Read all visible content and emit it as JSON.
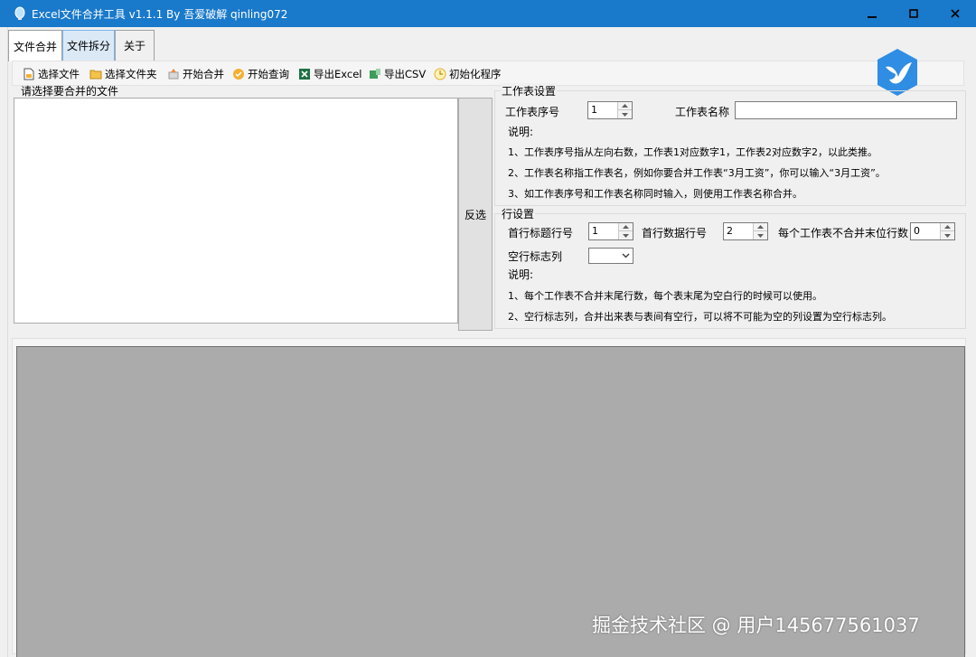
{
  "window": {
    "title": "Excel文件合并工具 v1.1.1 By 吾爱破解 qinling072",
    "colors": {
      "titlebar": "#1979ca",
      "grid_bg": "#ababab"
    }
  },
  "tabs": [
    {
      "label": "文件合并",
      "selected": true
    },
    {
      "label": "文件拆分",
      "selected": false
    },
    {
      "label": "关于",
      "selected": false
    }
  ],
  "toolbar": {
    "select_file": "选择文件",
    "select_folder": "选择文件夹",
    "start_merge": "开始合并",
    "start_query": "开始查询",
    "export_excel": "导出Excel",
    "export_csv": "导出CSV",
    "init_program": "初始化程序"
  },
  "files": {
    "label": "请选择要合并的文件",
    "invert_label": "反选"
  },
  "sheet_settings": {
    "legend": "工作表设置",
    "index_label": "工作表序号",
    "index_value": "1",
    "name_label": "工作表名称",
    "name_value": "",
    "notes_title": "说明:",
    "notes": [
      "1、工作表序号指从左向右数，工作表1对应数字1，工作表2对应数字2，以此类推。",
      "2、工作表名称指工作表名，例如你要合并工作表“3月工资”，你可以输入“3月工资”。",
      "3、如工作表序号和工作表名称同时输入，则使用工作表名称合并。"
    ]
  },
  "row_settings": {
    "legend": "行设置",
    "header_row_label": "首行标题行号",
    "header_row_value": "1",
    "data_row_label": "首行数据行号",
    "data_row_value": "2",
    "skip_tail_label": "每个工作表不合并末位行数",
    "skip_tail_value": "0",
    "empty_col_label": "空行标志列",
    "empty_col_value": "",
    "notes_title": "说明:",
    "notes": [
      "1、每个工作表不合并末尾行数，每个表末尾为空白行的时候可以使用。",
      "2、空行标志列，合并出来表与表间有空行，可以将不可能为空的列设置为空行标志列。"
    ]
  },
  "watermark": "掘金技术社区 @ 用户145677561037"
}
